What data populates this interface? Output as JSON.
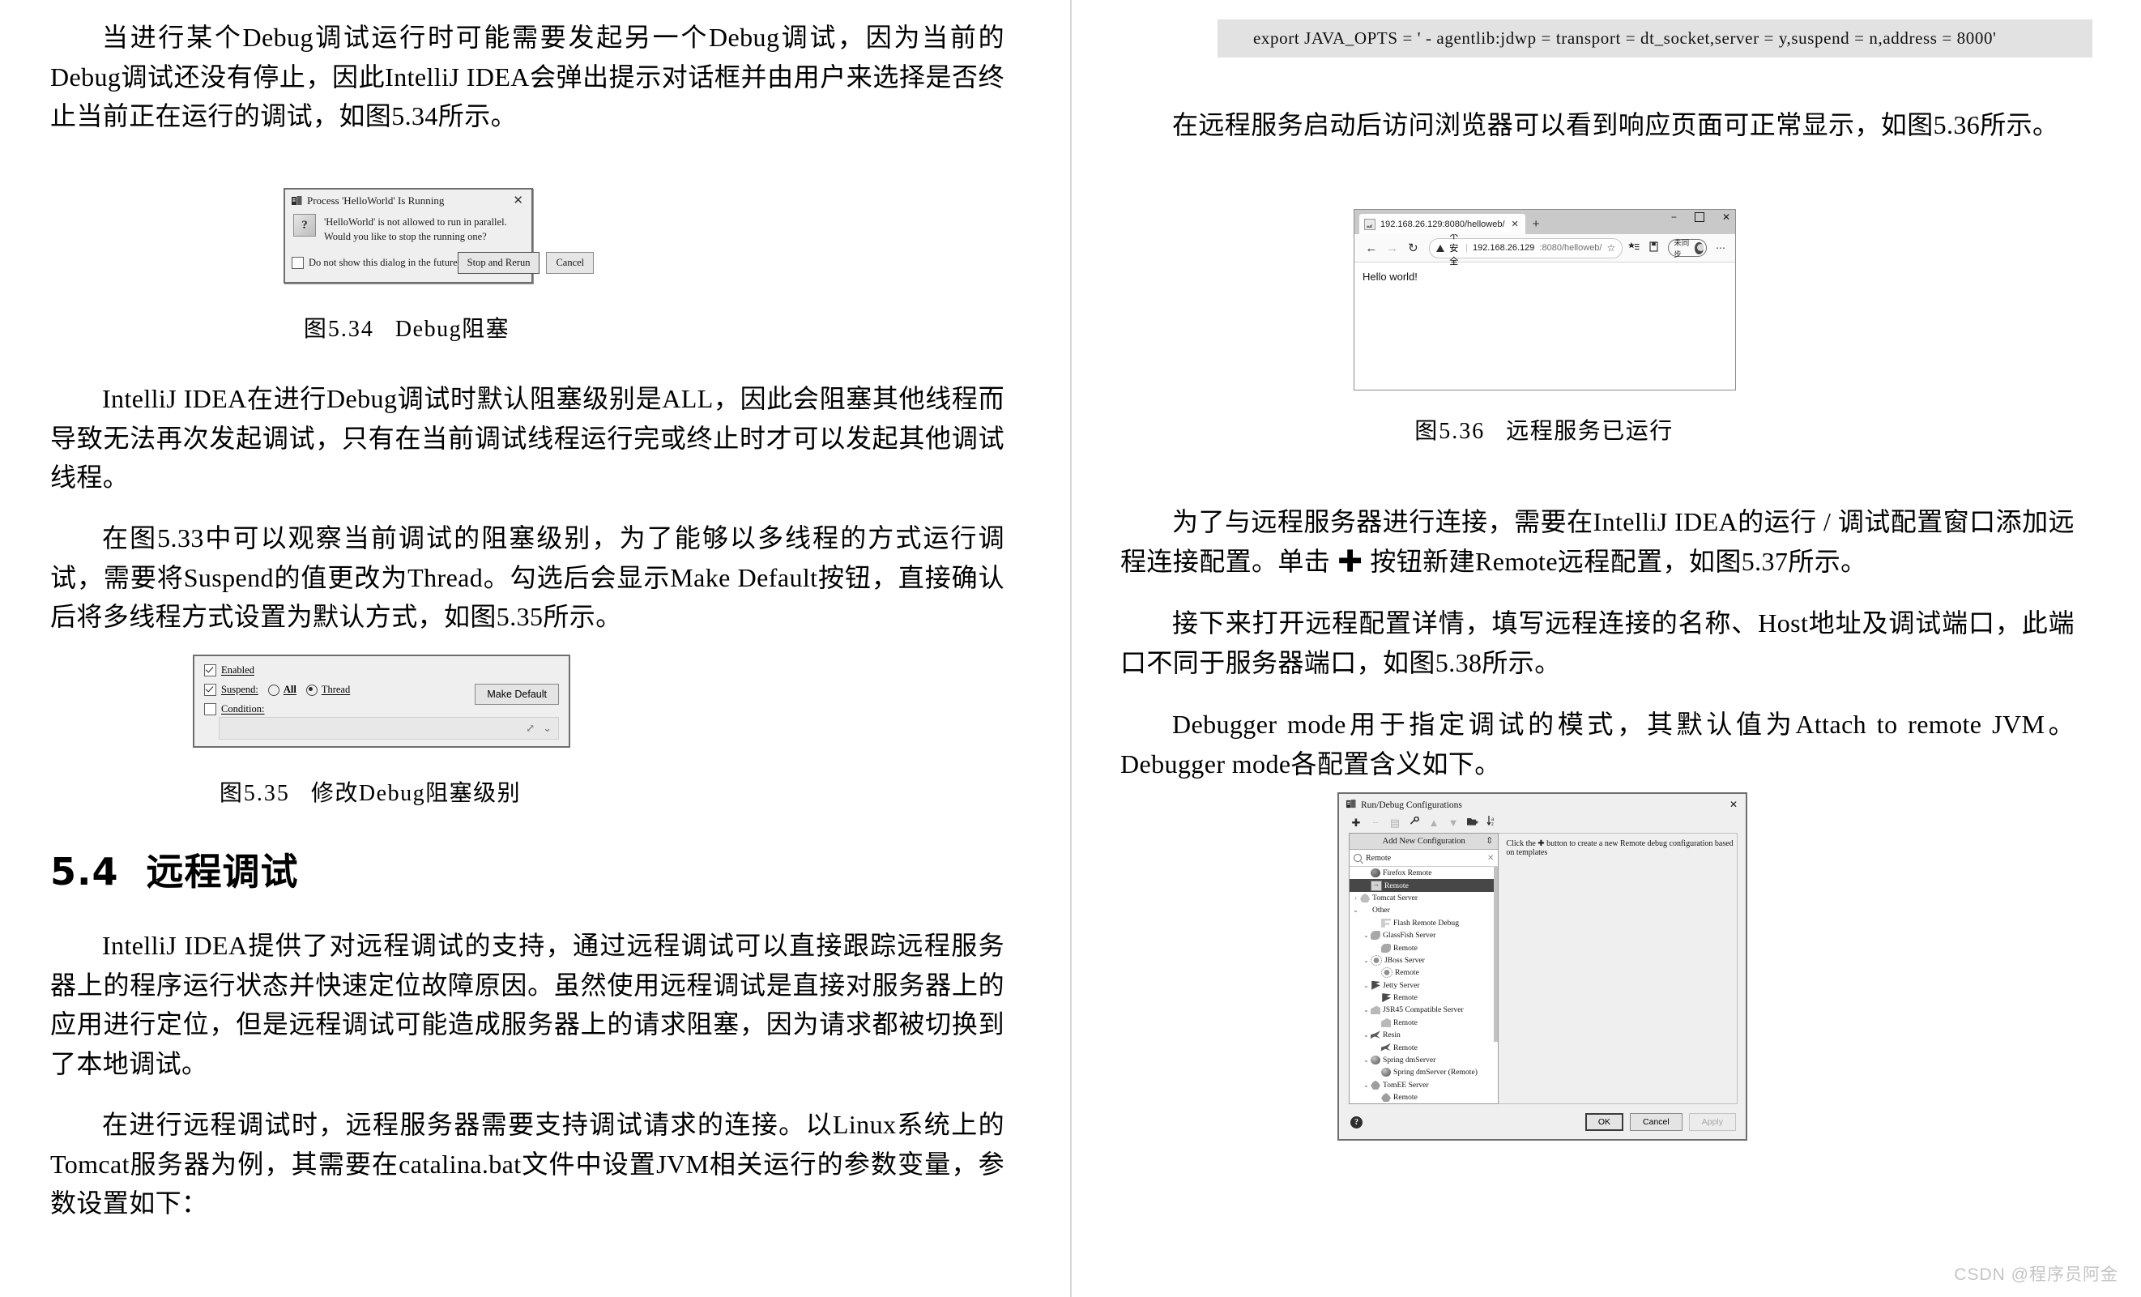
{
  "left_column": {
    "paragraph_1": "当进行某个Debug调试运行时可能需要发起另一个Debug调试，因为当前的Debug调试还没有停止，因此IntelliJ IDEA会弹出提示对话框并由用户来选择是否终止当前正在运行的调试，如图5.34所示。",
    "figure_534": {
      "dialog": {
        "title": "Process 'HelloWorld' Is Running",
        "app_icon": "idea-icon",
        "close_label": "✕",
        "question_icon": "?",
        "message_line_1": "'HelloWorld' is not allowed to run in parallel.",
        "message_line_2": "Would you like to stop the running one?",
        "checkbox_label": "Do not show this dialog in the future",
        "checkbox_checked": false,
        "button_primary": "Stop and Rerun",
        "button_secondary": "Cancel"
      },
      "caption_number": "图5.34",
      "caption_text": "Debug阻塞"
    },
    "paragraph_2": "IntelliJ IDEA在进行Debug调试时默认阻塞级别是ALL，因此会阻塞其他线程而导致无法再次发起调试，只有在当前调试线程运行完或终止时才可以发起其他调试线程。",
    "paragraph_3": "在图5.33中可以观察当前调试的阻塞级别，为了能够以多线程的方式运行调试，需要将Suspend的值更改为Thread。勾选后会显示Make Default按钮，直接确认后将多线程方式设置为默认方式，如图5.35所示。",
    "figure_535": {
      "panel": {
        "enabled_label": "Enabled",
        "enabled_checked": true,
        "suspend_label": "Suspend:",
        "suspend_checked": true,
        "radio_all": "All",
        "radio_thread": "Thread",
        "radio_selected": "Thread",
        "condition_label": "Condition:",
        "condition_checked": false,
        "make_default_button": "Make Default",
        "expand_icon": "⤢",
        "dropdown_icon": "⌄"
      },
      "caption_number": "图5.35",
      "caption_text": "修改Debug阻塞级别"
    },
    "section": {
      "number": "5.4",
      "title": "远程调试"
    },
    "paragraph_4": "IntelliJ IDEA提供了对远程调试的支持，通过远程调试可以直接跟踪远程服务器上的程序运行状态并快速定位故障原因。虽然使用远程调试是直接对服务器上的应用进行定位，但是远程调试可能造成服务器上的请求阻塞，因为请求都被切换到了本地调试。",
    "paragraph_5": "在进行远程调试时，远程服务器需要支持调试请求的连接。以Linux系统上的Tomcat服务器为例，其需要在catalina.bat文件中设置JVM相关运行的参数变量，参数设置如下："
  },
  "right_column": {
    "code_block": "export JAVA_OPTS = ' - agentlib:jdwp = transport = dt_socket,server = y,suspend = n,address = 8000'",
    "paragraph_1": "在远程服务启动后访问浏览器可以看到响应页面可正常显示，如图5.36所示。",
    "figure_536": {
      "browser": {
        "tab_title": "192.168.26.129:8080/helloweb/",
        "tab_close": "✕",
        "new_tab": "+",
        "minimize": "−",
        "maximize": "□",
        "close": "✕",
        "back_icon": "←",
        "forward_icon": "→",
        "reload_icon": "↻",
        "security_label": "不安全",
        "url_host": "192.168.26.129",
        "url_rest": ":8080/helloweb/",
        "favorite_icon": "☆",
        "collections_icon": "⊞",
        "sync_label": "未同步",
        "more_icon": "⋯",
        "page_content": "Hello world!"
      },
      "caption_number": "图5.36",
      "caption_text": "远程服务已运行"
    },
    "paragraph_2": "为了与远程服务器进行连接，需要在IntelliJ IDEA的运行 / 调试配置窗口添加远程连接配置。单击 ✚ 按钮新建Remote远程配置，如图5.37所示。",
    "paragraph_3": "接下来打开远程配置详情，填写远程连接的名称、Host地址及调试端口，此端口不同于服务器端口，如图5.38所示。",
    "paragraph_4": "Debugger mode用于指定调试的模式，其默认值为Attach to remote JVM。Debugger mode各配置含义如下。",
    "figure_537": {
      "dialog": {
        "title": "Run/Debug Configurations",
        "close_label": "✕",
        "toolbar_icons": [
          "add-icon",
          "remove-icon",
          "copy-icon",
          "edit-icon",
          "move-up-icon",
          "move-down-icon",
          "folder-icon",
          "sort-icon"
        ],
        "popup_header": "Add New Configuration",
        "pin_icon": "pin-icon",
        "search_value": "Remote",
        "search_clear": "✕",
        "tree": [
          {
            "label": "Firefox Remote",
            "indent": 1,
            "chevron": "",
            "icon": "firefox",
            "selected": false
          },
          {
            "label": "Remote",
            "indent": 1,
            "chevron": "",
            "icon": "remote",
            "selected": true
          },
          {
            "label": "Tomcat Server",
            "indent": 0,
            "chevron": "›",
            "icon": "tomcat",
            "selected": false
          },
          {
            "label": "Other",
            "indent": 0,
            "chevron": "⌄",
            "icon": "",
            "selected": false
          },
          {
            "label": "Flash Remote Debug",
            "indent": 2,
            "chevron": "",
            "icon": "flash",
            "selected": false
          },
          {
            "label": "GlassFish Server",
            "indent": 1,
            "chevron": "⌄",
            "icon": "glassfish",
            "selected": false
          },
          {
            "label": "Remote",
            "indent": 2,
            "chevron": "",
            "icon": "glassfish",
            "selected": false
          },
          {
            "label": "JBoss Server",
            "indent": 1,
            "chevron": "⌄",
            "icon": "jboss",
            "selected": false
          },
          {
            "label": "Remote",
            "indent": 2,
            "chevron": "",
            "icon": "jboss",
            "selected": false
          },
          {
            "label": "Jetty Server",
            "indent": 1,
            "chevron": "⌄",
            "icon": "jetty",
            "selected": false
          },
          {
            "label": "Remote",
            "indent": 2,
            "chevron": "",
            "icon": "jetty",
            "selected": false
          },
          {
            "label": "JSR45 Compatible Server",
            "indent": 1,
            "chevron": "⌄",
            "icon": "jsr45",
            "selected": false
          },
          {
            "label": "Remote",
            "indent": 2,
            "chevron": "",
            "icon": "jsr45",
            "selected": false
          },
          {
            "label": "Resin",
            "indent": 1,
            "chevron": "⌄",
            "icon": "resin",
            "selected": false
          },
          {
            "label": "Remote",
            "indent": 2,
            "chevron": "",
            "icon": "resin",
            "selected": false
          },
          {
            "label": "Spring dmServer",
            "indent": 1,
            "chevron": "⌄",
            "icon": "spring",
            "selected": false
          },
          {
            "label": "Spring dmServer (Remote)",
            "indent": 2,
            "chevron": "",
            "icon": "spring",
            "selected": false
          },
          {
            "label": "TomEE Server",
            "indent": 1,
            "chevron": "⌄",
            "icon": "tomee",
            "selected": false
          },
          {
            "label": "Remote",
            "indent": 2,
            "chevron": "",
            "icon": "tomee",
            "selected": false
          }
        ],
        "hint_text": "Click the ✚ button to create a new Remote debug configuration based on templates",
        "help_icon": "?",
        "button_ok": "OK",
        "button_cancel": "Cancel",
        "button_apply": "Apply"
      }
    }
  },
  "watermark": "CSDN @程序员阿金"
}
